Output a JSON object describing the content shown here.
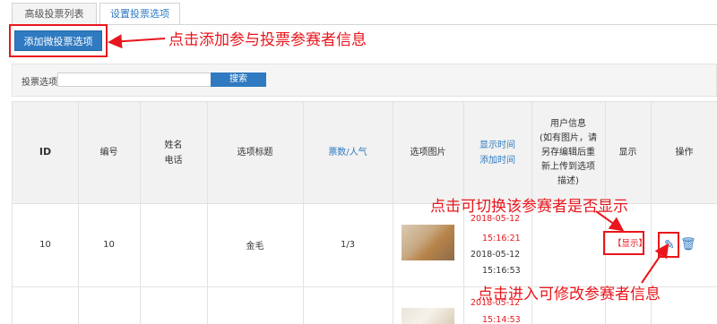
{
  "tabs": [
    {
      "label": "高级投票列表"
    },
    {
      "label": "设置投票选项"
    }
  ],
  "add_button": {
    "label": "添加微投票选项"
  },
  "annotations": {
    "add_note": "点击添加参与投票参赛者信息",
    "toggle_note": "点击可切换该参赛者是否显示",
    "edit_note": "点击进入可修改参赛者信息"
  },
  "search": {
    "label": "投票选项",
    "value": "",
    "button": "搜索"
  },
  "table": {
    "headers": {
      "id": "ID",
      "number": "编号",
      "name_line1": "姓名",
      "name_line2": "电话",
      "title": "选项标题",
      "votes": "票数/",
      "popularity": "人气",
      "image": "选项图片",
      "show_time": "显示时间",
      "add_time": "添加时间",
      "userinfo_l1": "用户信息",
      "userinfo_l2": "(如有图片，请",
      "userinfo_l3": "另存编辑后重",
      "userinfo_l4": "新上传到选项",
      "userinfo_l5": "描述)",
      "display": "显示",
      "actions": "操作"
    },
    "rows": [
      {
        "id": "10",
        "number": "10",
        "title": "金毛",
        "votes": "1/3",
        "show_date": "2018-05-12",
        "show_clock": "15:16:21",
        "add_date": "2018-05-12",
        "add_clock": "15:16:53",
        "display": "【显示】"
      },
      {
        "show_date": "2018-05-12",
        "show_clock": "15:14:53"
      }
    ]
  },
  "colors": {
    "accent": "#2f7ac0",
    "annotation": "#e8161c"
  },
  "icons": [
    "pencil-icon",
    "trash-icon"
  ]
}
